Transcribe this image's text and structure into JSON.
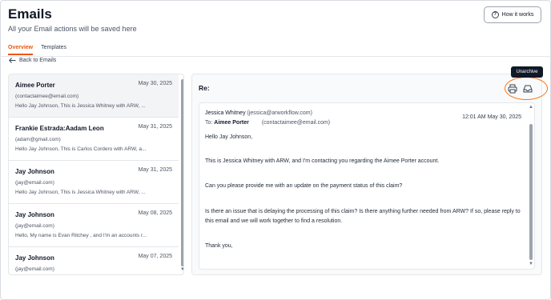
{
  "header": {
    "title": "Emails",
    "subtitle": "All your Email actions will be saved here",
    "help_button": "How it works"
  },
  "tabs": [
    {
      "label": "Overview",
      "active": true
    },
    {
      "label": "Templates",
      "active": false
    }
  ],
  "back_link": "Back to Emails",
  "email_list": [
    {
      "name": "Aimee Porter",
      "date": "May 30, 2025",
      "email": "(contactaimee@email.com)",
      "preview": "Hello Jay Johnson, This is Jessica Whitney with ARW, ..."
    },
    {
      "name": "Frankie Estrada:Aadam Leon",
      "date": "May 31, 2025",
      "email": "(adam@gmail.com)",
      "preview": "Hello Jay Johnson, This is Carlos Cordero with ARW, a..."
    },
    {
      "name": "Jay Johnson",
      "date": "May 31, 2025",
      "email": "(jay@email.com)",
      "preview": "Hello Jay Johnson, This is Jessica Whitney with ARW, ..."
    },
    {
      "name": "Jay Johnson",
      "date": "May 08, 2025",
      "email": "(jay@email.com)",
      "preview": "Hello, My name is Evan Ritchey , and I'm an accounts r..."
    },
    {
      "name": "Jay Johnson",
      "date": "May 07, 2025",
      "email": "(jay@email.com)",
      "preview": ""
    }
  ],
  "detail": {
    "subject": "Re:",
    "tooltip": "Unarchive",
    "icons": [
      "print-icon",
      "inbox-icon"
    ],
    "from_name": "Jessica Whitney",
    "from_email": "(jessica@arworkflow.com)",
    "to_label": "To:",
    "to_name": "Aimee Porter",
    "to_email": "(contactaimee@email.com)",
    "timestamp": "12:01 AM May 30, 2025",
    "body": [
      "Hello Jay Johnson,",
      "This is Jessica Whitney with ARW, and I'm contacting you regarding the Aimee Porter account.",
      "Can you please provide me with an update on the payment status of this claim?",
      "Is there an issue that is delaying the processing of this claim? Is there anything further needed from ARW? If so, please reply to this email and we will work together to find a resolution.",
      "Thank you,"
    ]
  },
  "colors": {
    "accent": "#ea580c",
    "highlight_ring": "#f97316"
  }
}
